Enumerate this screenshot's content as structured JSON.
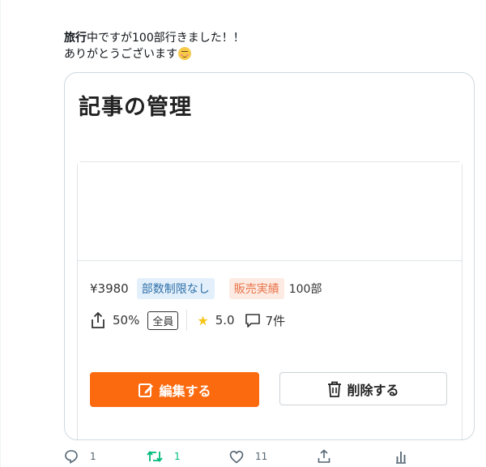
{
  "tweet": {
    "text_bold": "旅行",
    "text_line1_rest": "中ですが100部行きました！！",
    "text_line2": "ありがとうございます",
    "emoji": "smiling-face-with-blush-emoji"
  },
  "card": {
    "title": "記事の管理",
    "article": {
      "price": "¥3980",
      "badge_unlimited": "部数制限なし",
      "badge_sales": "販売実績",
      "sales_count": "100部",
      "share_percent": "50%",
      "share_target": "全員",
      "rating": "5.0",
      "comments": "7件"
    },
    "edit_button_label": "編集する",
    "delete_button_label": "削除する",
    "colors": {
      "edit_button": "#fc6a0f",
      "badge_blue_bg": "#e3f0fb",
      "badge_orange_bg": "#fdebe3",
      "star": "#f5c518"
    }
  },
  "actions": {
    "reply_count": "1",
    "retweet_count": "1",
    "like_count": "11",
    "icons": [
      "reply-icon",
      "retweet-icon",
      "like-icon",
      "share-icon",
      "analytics-icon"
    ]
  }
}
